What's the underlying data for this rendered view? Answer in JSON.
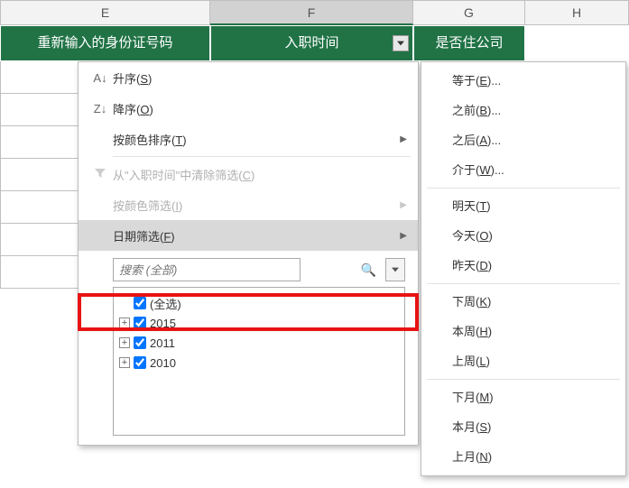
{
  "columns": {
    "E": {
      "letter": "E",
      "header": "重新输入的身份证号码"
    },
    "F": {
      "letter": "F",
      "header": "入职时间"
    },
    "G": {
      "letter": "G",
      "header": "是否住公司"
    },
    "H": {
      "letter": "H"
    }
  },
  "menu": {
    "sort_asc": "升序(S)",
    "sort_desc": "降序(O)",
    "sort_color": "按颜色排序(T)",
    "clear_filter": "从\"入职时间\"中清除筛选(C)",
    "filter_color": "按颜色筛选(I)",
    "date_filter": "日期筛选(F)",
    "search_placeholder": "搜索 (全部)",
    "tree": {
      "select_all": "(全选)",
      "years": [
        "2015",
        "2011",
        "2010"
      ]
    }
  },
  "submenu": {
    "equals": "等于(E)...",
    "before": "之前(B)...",
    "after": "之后(A)...",
    "between": "介于(W)...",
    "tomorrow": "明天(T)",
    "today": "今天(O)",
    "yesterday": "昨天(D)",
    "next_week": "下周(K)",
    "this_week": "本周(H)",
    "last_week": "上周(L)",
    "next_month": "下月(M)",
    "this_month": "本月(S)",
    "last_month": "上月(N)"
  }
}
